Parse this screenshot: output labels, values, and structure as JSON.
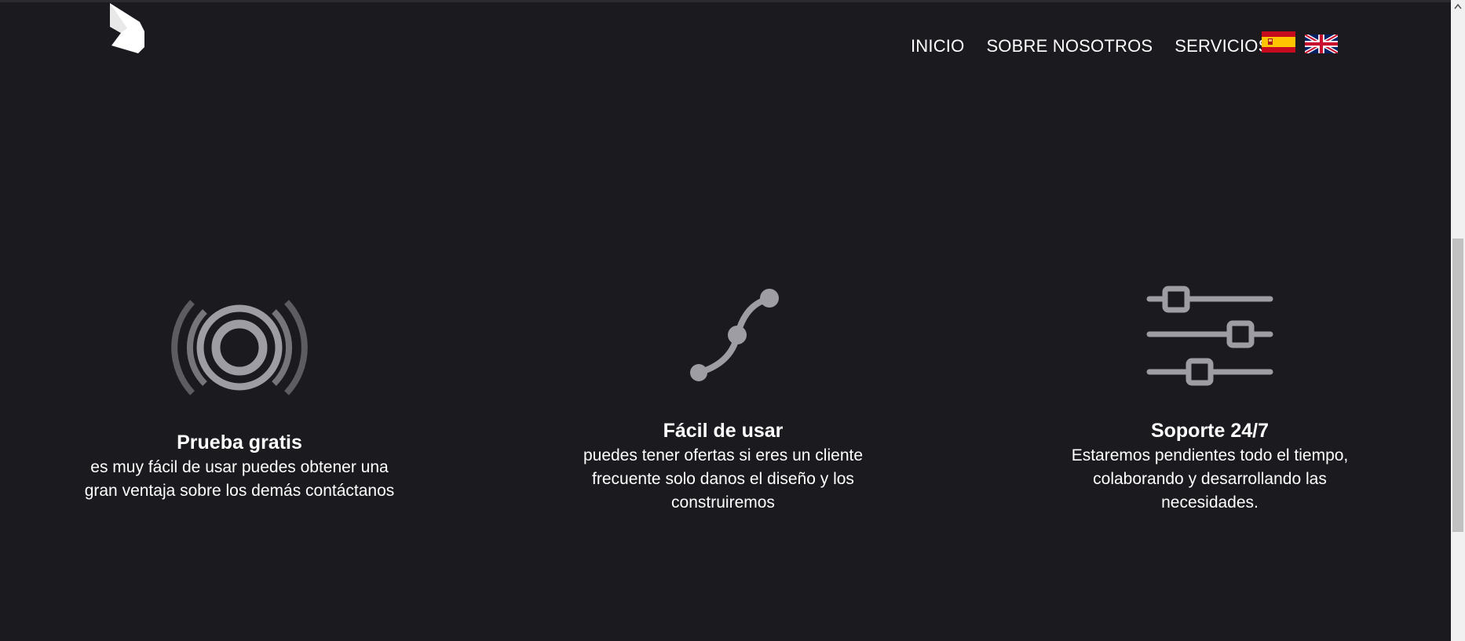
{
  "header": {
    "logo_icon": "chevron-logo",
    "nav": [
      {
        "label": "INICIO"
      },
      {
        "label": "SOBRE NOSOTROS"
      },
      {
        "label": "SERVICIOS"
      }
    ],
    "languages": [
      {
        "icon": "spain-flag-icon"
      },
      {
        "icon": "uk-flag-icon"
      }
    ]
  },
  "features": [
    {
      "icon": "broadcast-signal-icon",
      "title": "Prueba gratis",
      "line1": "es muy fácil de usar puedes obtener una",
      "line2": "gran ventaja sobre los demás contáctanos",
      "line3": ""
    },
    {
      "icon": "curve-nodes-icon",
      "title": "Fácil de usar",
      "line1": "puedes tener ofertas si eres un cliente",
      "line2": "frecuente solo danos el diseño y los",
      "line3": "construiremos"
    },
    {
      "icon": "sliders-icon",
      "title": "Soporte 24/7",
      "line1": "Estaremos pendientes todo el tiempo,",
      "line2": "colaborando y desarrollando las",
      "line3": "necesidades."
    }
  ],
  "colors": {
    "background": "#1b1a1f",
    "text": "#ffffff",
    "icon_gray": "#9e9da3",
    "icon_dark_gray": "#5d5c61"
  }
}
